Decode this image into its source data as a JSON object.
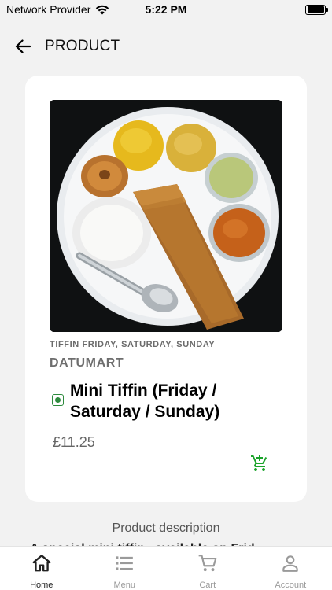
{
  "status_bar": {
    "carrier": "Network Provider",
    "time": "5:22 PM"
  },
  "header": {
    "title": "PRODUCT"
  },
  "product": {
    "category": "TIFFIN FRIDAY, SATURDAY, SUNDAY",
    "brand": "DATUMART",
    "name": "Mini Tiffin (Friday / Saturday / Sunday)",
    "price": "£11.25",
    "image_icon": "tiffin-plate-image",
    "veg_color": "#2e8b3e",
    "cart_color": "#1aa32a"
  },
  "description": {
    "heading": "Product description",
    "text_visible": "A special mini tiffin , available on Frid"
  },
  "bottom_nav": {
    "items": [
      {
        "label": "Home",
        "icon": "home-icon",
        "active": true
      },
      {
        "label": "Menu",
        "icon": "menu-list-icon",
        "active": false
      },
      {
        "label": "Cart",
        "icon": "cart-icon",
        "active": false
      },
      {
        "label": "Account",
        "icon": "account-icon",
        "active": false
      }
    ]
  }
}
